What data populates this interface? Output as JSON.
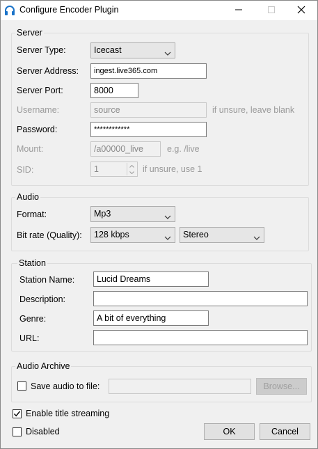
{
  "window": {
    "title": "Configure Encoder Plugin"
  },
  "server": {
    "group_label": "Server",
    "type_label": "Server Type:",
    "type_value": "Icecast",
    "address_label": "Server Address:",
    "address_value": "ingest.live365.com",
    "port_label": "Server Port:",
    "port_value": "8000",
    "username_label": "Username:",
    "username_value": "source",
    "username_hint": "if unsure, leave blank",
    "password_label": "Password:",
    "password_value": "************",
    "mount_label": "Mount:",
    "mount_value": "/a00000_live",
    "mount_hint": "e.g. /live",
    "sid_label": "SID:",
    "sid_value": "1",
    "sid_hint": "if unsure, use 1"
  },
  "audio": {
    "group_label": "Audio",
    "format_label": "Format:",
    "format_value": "Mp3",
    "bitrate_label": "Bit rate (Quality):",
    "bitrate_value": "128 kbps",
    "channels_value": "Stereo"
  },
  "station": {
    "group_label": "Station",
    "name_label": "Station Name:",
    "name_value": "Lucid Dreams",
    "description_label": "Description:",
    "description_value": "",
    "genre_label": "Genre:",
    "genre_value": "A bit of everything",
    "url_label": "URL:",
    "url_value": ""
  },
  "archive": {
    "group_label": "Audio Archive",
    "save_label": "Save audio to file:",
    "save_checked": false,
    "path_value": "",
    "browse_label": "Browse..."
  },
  "footer": {
    "title_streaming_label": "Enable title streaming",
    "title_streaming_checked": true,
    "disabled_label": "Disabled",
    "disabled_checked": false,
    "ok_label": "OK",
    "cancel_label": "Cancel"
  },
  "colors": {
    "accent": "#0078d7",
    "disabled_text": "#9a9a9a",
    "window_bg": "#f0f0f0"
  },
  "icons": {
    "app": "headphones-icon",
    "minimize": "minimize-icon",
    "maximize": "maximize-icon",
    "close": "close-icon"
  }
}
